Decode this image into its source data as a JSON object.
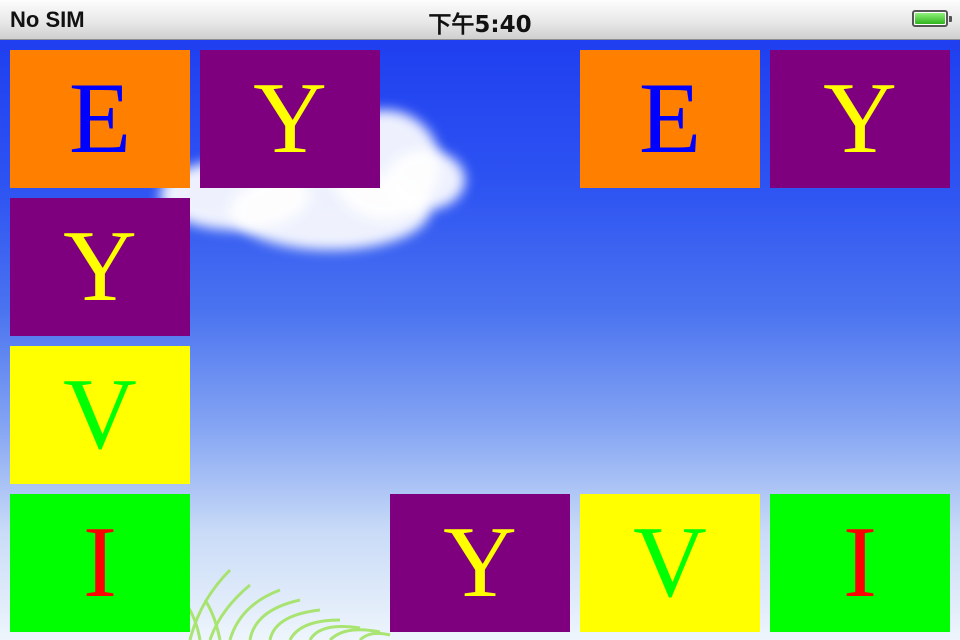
{
  "statusbar": {
    "carrier": "No SIM",
    "time": "下午5:40",
    "battery_level": 1.0
  },
  "colors": {
    "orange": "#ff7f00",
    "purple": "#7f007f",
    "yellow": "#ffff00",
    "green": "#00ff00",
    "blue": "#0000ff",
    "red": "#ff0000"
  },
  "tiles": [
    {
      "letter": "E",
      "bg": "#ff7f00",
      "fg": "#0000ff"
    },
    {
      "letter": "Y",
      "bg": "#7f007f",
      "fg": "#ffff00"
    },
    {
      "letter": "E",
      "bg": "#ff7f00",
      "fg": "#0000ff"
    },
    {
      "letter": "Y",
      "bg": "#7f007f",
      "fg": "#ffff00"
    },
    {
      "letter": "Y",
      "bg": "#7f007f",
      "fg": "#ffff00"
    },
    {
      "letter": "V",
      "bg": "#ffff00",
      "fg": "#00ff00"
    },
    {
      "letter": "I",
      "bg": "#00ff00",
      "fg": "#ff0000"
    },
    {
      "letter": "Y",
      "bg": "#7f007f",
      "fg": "#ffff00"
    },
    {
      "letter": "V",
      "bg": "#ffff00",
      "fg": "#00ff00"
    },
    {
      "letter": "I",
      "bg": "#00ff00",
      "fg": "#ff0000"
    }
  ]
}
